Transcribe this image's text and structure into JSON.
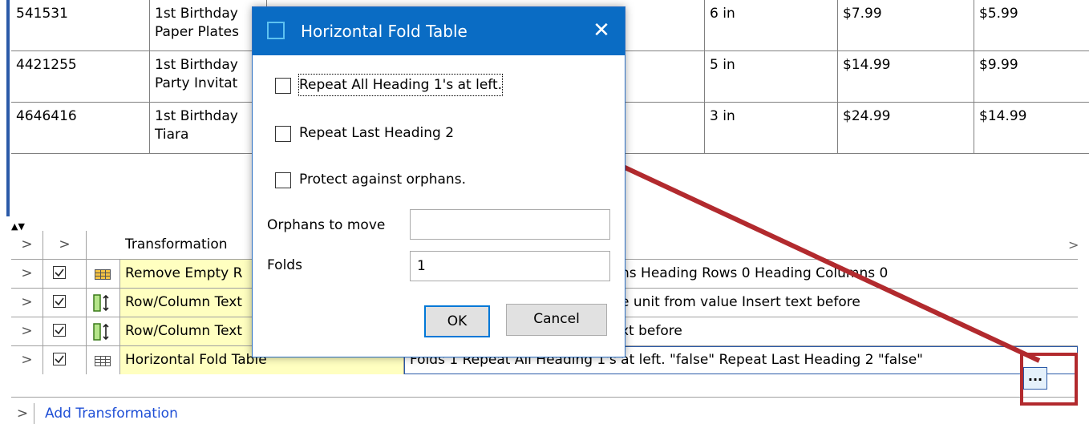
{
  "top_table": {
    "rows": [
      {
        "sku": "541531",
        "name_line1": "1st Birthday",
        "name_line2": "Paper Plates",
        "size": "6 in",
        "price": "$7.99",
        "sale": "$5.99"
      },
      {
        "sku": "4421255",
        "name_line1": "1st Birthday",
        "name_line2": "Party Invitat",
        "size": "5 in",
        "price": "$14.99",
        "sale": "$9.99"
      },
      {
        "sku": "4646416",
        "name_line1": "1st Birthday",
        "name_line2": "Tiara",
        "size": "3 in",
        "price": "$24.99",
        "sale": "$14.99"
      }
    ]
  },
  "grid": {
    "header": {
      "exp1": ">",
      "exp2": ">",
      "transformation": "Transformation",
      "scroll_arrow": ">"
    },
    "rows": [
      {
        "expander": ">",
        "name": "Remove Empty R",
        "description": "ns Heading Rows 0 Heading Columns 0",
        "icon": "table-yellow-icon"
      },
      {
        "expander": ">",
        "name": "Row/Column Text",
        "description": "e unit from value Insert text before",
        "icon": "row-column-text-icon"
      },
      {
        "expander": ">",
        "name": "Row/Column Text",
        "description": "xt before",
        "icon": "row-column-text-icon"
      },
      {
        "expander": ">",
        "name": "Horizontal Fold Table",
        "description": "Folds 1 Repeat All Heading 1's at left. \"false\" Repeat Last Heading 2 \"false\"",
        "icon": "table-icon"
      }
    ],
    "ellipsis_label": "...",
    "add_transformation": {
      "expander": ">",
      "label": "Add Transformation"
    }
  },
  "dialog": {
    "title": "Horizontal Fold Table",
    "close_glyph": "✕",
    "options": [
      {
        "label": "Repeat All Heading 1's at left.",
        "checked": false
      },
      {
        "label": "Repeat Last Heading 2",
        "checked": false
      },
      {
        "label": "Protect against orphans.",
        "checked": false
      }
    ],
    "orphans_label": "Orphans to move",
    "orphans_value": "",
    "folds_label": "Folds",
    "folds_value": "1",
    "ok_label": "OK",
    "cancel_label": "Cancel"
  },
  "colors": {
    "titlebar": "#0a6cc4",
    "annotation_red": "#b22a2e",
    "name_cell_bg": "#ffffc0",
    "link_blue": "#1f4fd6"
  }
}
